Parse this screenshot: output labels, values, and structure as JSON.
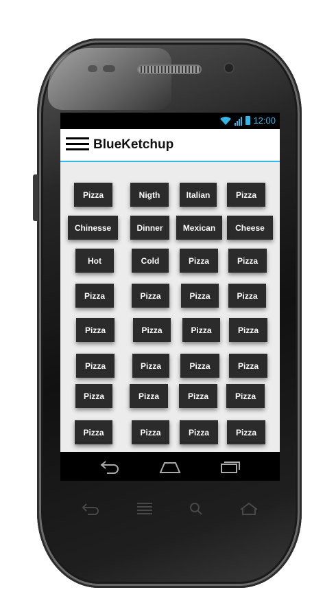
{
  "status_bar": {
    "time": "12:00",
    "accent_color": "#33b5e5"
  },
  "app_bar": {
    "title": "BlueKetchup",
    "menu_icon": "hamburger-menu-icon"
  },
  "grid": {
    "rows": [
      [
        "Pizza",
        "Nigth",
        "Italian",
        "Pizza"
      ],
      [
        "Chinesse",
        "Dinner",
        "Mexican",
        "Cheese"
      ],
      [
        "Hot",
        "Cold",
        "Pizza",
        "Pizza"
      ],
      [
        "Pizza",
        "Pizza",
        "Pizza",
        "Pizza"
      ],
      [
        "Pizza",
        "Pizza",
        "Pizza",
        "Pizza"
      ],
      [
        "Pizza",
        "Pizza",
        "Pizza",
        "Pizza"
      ],
      [
        "Pizza",
        "Pizza",
        "Pizza",
        "Pizza"
      ],
      [
        "Pizza",
        "Pizza",
        "Pizza",
        "Pizza"
      ]
    ]
  },
  "nav_bar": {
    "icons": [
      "back-icon",
      "home-icon",
      "recents-icon"
    ]
  },
  "hardware_keys": [
    "back-key-icon",
    "menu-key-icon",
    "search-key-icon",
    "home-key-icon"
  ]
}
